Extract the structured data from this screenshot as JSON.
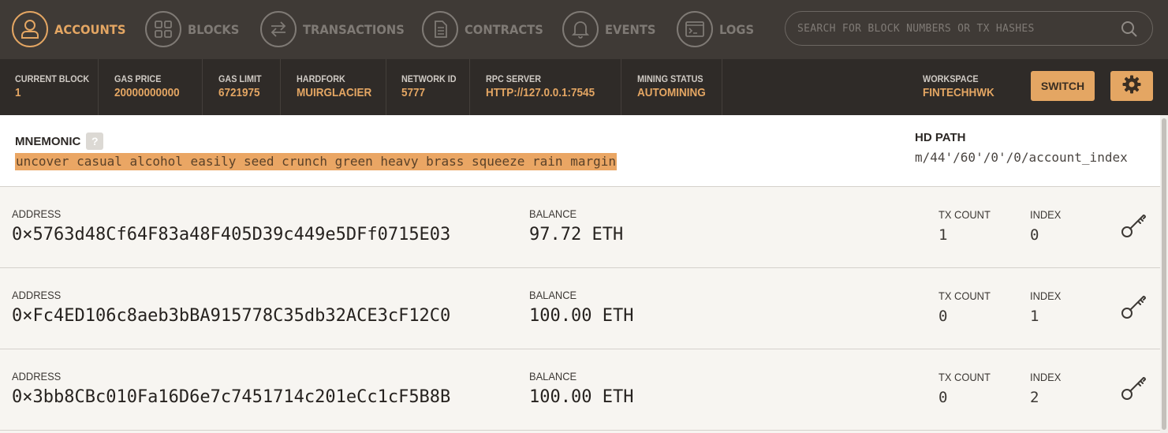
{
  "nav": {
    "items": [
      {
        "label": "ACCOUNTS",
        "icon": "person-icon",
        "active": true
      },
      {
        "label": "BLOCKS",
        "icon": "grid-icon",
        "active": false
      },
      {
        "label": "TRANSACTIONS",
        "icon": "arrows-icon",
        "active": false
      },
      {
        "label": "CONTRACTS",
        "icon": "document-icon",
        "active": false
      },
      {
        "label": "EVENTS",
        "icon": "bell-icon",
        "active": false
      },
      {
        "label": "LOGS",
        "icon": "terminal-icon",
        "active": false
      }
    ],
    "search_placeholder": "SEARCH FOR BLOCK NUMBERS OR TX HASHES"
  },
  "status": {
    "current_block": {
      "label": "CURRENT BLOCK",
      "value": "1"
    },
    "gas_price": {
      "label": "GAS PRICE",
      "value": "20000000000"
    },
    "gas_limit": {
      "label": "GAS LIMIT",
      "value": "6721975"
    },
    "hardfork": {
      "label": "HARDFORK",
      "value": "MUIRGLACIER"
    },
    "network_id": {
      "label": "NETWORK ID",
      "value": "5777"
    },
    "rpc_server": {
      "label": "RPC SERVER",
      "value": "HTTP://127.0.0.1:7545"
    },
    "mining_status": {
      "label": "MINING STATUS",
      "value": "AUTOMINING"
    },
    "workspace": {
      "label": "WORKSPACE",
      "value": "FINTECHHWK"
    },
    "switch_label": "SWITCH"
  },
  "mnemonic": {
    "label": "MNEMONIC",
    "help": "?",
    "words": "uncover casual alcohol easily seed crunch green heavy brass squeeze rain margin",
    "hd_path_label": "HD PATH",
    "hd_path_value": "m/44'/60'/0'/0/account_index"
  },
  "accounts": [
    {
      "address_label": "ADDRESS",
      "address": "0×5763d48Cf64F83a48F405D39c449e5DFf0715E03",
      "balance_label": "BALANCE",
      "balance": "97.72 ETH",
      "tx_count_label": "TX COUNT",
      "tx_count": "1",
      "index_label": "INDEX",
      "index": "0"
    },
    {
      "address_label": "ADDRESS",
      "address": "0×Fc4ED106c8aeb3bBA915778C35db32ACE3cF12C0",
      "balance_label": "BALANCE",
      "balance": "100.00 ETH",
      "tx_count_label": "TX COUNT",
      "tx_count": "0",
      "index_label": "INDEX",
      "index": "1"
    },
    {
      "address_label": "ADDRESS",
      "address": "0×3bb8CBc010Fa16D6e7c7451714c201eCc1cF5B8B",
      "balance_label": "BALANCE",
      "balance": "100.00 ETH",
      "tx_count_label": "TX COUNT",
      "tx_count": "0",
      "index_label": "INDEX",
      "index": "2"
    }
  ],
  "colors": {
    "accent": "#e4a663",
    "nav_bg": "#3f3a36",
    "status_bg": "#2f2b28"
  }
}
